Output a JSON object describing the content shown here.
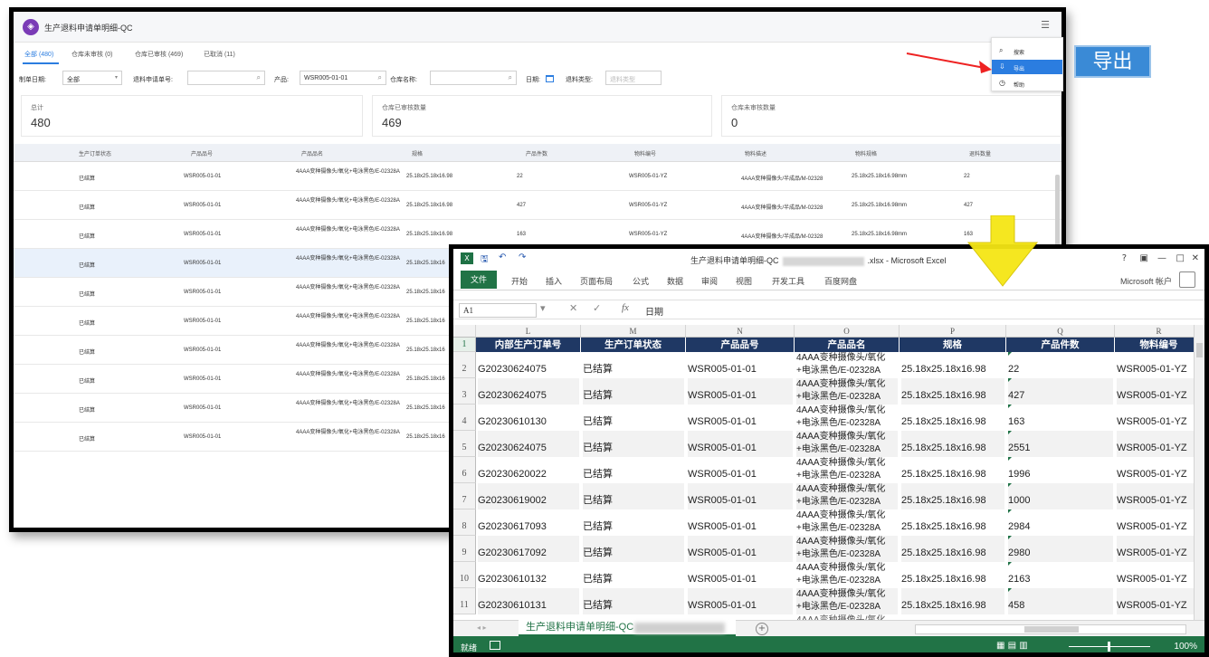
{
  "web": {
    "app_title": "生产退料申请单明细-QC",
    "tabs": [
      "全部 (480)",
      "仓库未审核 (0)",
      "仓库已审核 (469)",
      "已取消 (11)"
    ],
    "filters": {
      "date_label": "制单日期:",
      "date_value": "全部",
      "request_no_label": "退料申请单号:",
      "product_label": "产品:",
      "product_value": "WSR005-01-01",
      "warehouse_label": "仓库名称:",
      "day_label": "日期:",
      "type_label": "退料类型:",
      "type_placeholder": "退料类型"
    },
    "summary": [
      {
        "label": "总计",
        "value": "480"
      },
      {
        "label": "仓库已审核数量",
        "value": "469"
      },
      {
        "label": "仓库未审核数量",
        "value": "0"
      }
    ],
    "columns": [
      "生产订单状态",
      "产品品号",
      "产品品名",
      "规格",
      "产品件数",
      "物料编号",
      "物料描述",
      "物料规格",
      "退料数量"
    ],
    "rows": [
      {
        "status": "已结算",
        "code": "WSR005-01-01",
        "name": "4AAA变种摄像头/氧化+电泳黑色/E-02328A",
        "spec": "25.18x25.18x16.98",
        "qty": "22",
        "mat": "WSR005-01-YZ",
        "mdesc": "4AAA变种摄像头/半成品/M-02328",
        "mspec": "25.18x25.18x16.98mm",
        "ret": "22"
      },
      {
        "status": "已结算",
        "code": "WSR005-01-01",
        "name": "4AAA变种摄像头/氧化+电泳黑色/E-02328A",
        "spec": "25.18x25.18x16.98",
        "qty": "427",
        "mat": "WSR005-01-YZ",
        "mdesc": "4AAA变种摄像头/半成品/M-02328",
        "mspec": "25.18x25.18x16.98mm",
        "ret": "427"
      },
      {
        "status": "已结算",
        "code": "WSR005-01-01",
        "name": "4AAA变种摄像头/氧化+电泳黑色/E-02328A",
        "spec": "25.18x25.18x16.98",
        "qty": "163",
        "mat": "WSR005-01-YZ",
        "mdesc": "4AAA变种摄像头/半成品/M-02328",
        "mspec": "25.18x25.18x16.98mm",
        "ret": "163"
      },
      {
        "status": "已结算",
        "code": "WSR005-01-01",
        "name": "4AAA变种摄像头/氧化+电泳黑色/E-02328A",
        "spec": "25.18x25.18x16"
      },
      {
        "status": "已结算",
        "code": "WSR005-01-01",
        "name": "4AAA变种摄像头/氧化+电泳黑色/E-02328A",
        "spec": "25.18x25.18x16"
      },
      {
        "status": "已结算",
        "code": "WSR005-01-01",
        "name": "4AAA变种摄像头/氧化+电泳黑色/E-02328A",
        "spec": "25.18x25.18x16"
      },
      {
        "status": "已结算",
        "code": "WSR005-01-01",
        "name": "4AAA变种摄像头/氧化+电泳黑色/E-02328A",
        "spec": "25.18x25.18x16"
      },
      {
        "status": "已结算",
        "code": "WSR005-01-01",
        "name": "4AAA变种摄像头/氧化+电泳黑色/E-02328A",
        "spec": "25.18x25.18x16"
      },
      {
        "status": "已结算",
        "code": "WSR005-01-01",
        "name": "4AAA变种摄像头/氧化+电泳黑色/E-02328A",
        "spec": "25.18x25.18x16"
      },
      {
        "status": "已结算",
        "code": "WSR005-01-01",
        "name": "4AAA变种摄像头/氧化+电泳黑色/E-02328A",
        "spec": "25.18x25.18x16"
      }
    ],
    "menu": [
      {
        "icon": "search-icon",
        "label": "搜索"
      },
      {
        "icon": "export-icon",
        "label": "导出"
      },
      {
        "icon": "help-icon",
        "label": "帮助"
      }
    ],
    "callout": "导出"
  },
  "excel": {
    "title": "生产退料申请单明细-QC",
    "title_suffix": ".xlsx - Microsoft Excel",
    "ribbon_tabs": [
      "开始",
      "插入",
      "页面布局",
      "公式",
      "数据",
      "审阅",
      "视图",
      "开发工具",
      "百度网盘"
    ],
    "file_tab": "文件",
    "account": "Microsoft 帐户",
    "name_box": "A1",
    "formula_value": "日期",
    "col_letters": [
      "L",
      "M",
      "N",
      "O",
      "P",
      "Q",
      "R"
    ],
    "headers": [
      "内部生产订单号",
      "生产订单状态",
      "产品品号",
      "产品品名",
      "规格",
      "产品件数",
      "物料编号"
    ],
    "rows": [
      {
        "n": "2",
        "order": "G20230624075",
        "status": "已结算",
        "code": "WSR005-01-01",
        "name1": "4AAA变种摄像头/氧化",
        "name2": "+电泳黑色/E-02328A",
        "spec": "25.18x25.18x16.98",
        "qty": "22",
        "mat": "WSR005-01-YZ"
      },
      {
        "n": "3",
        "order": "G20230624075",
        "status": "已结算",
        "code": "WSR005-01-01",
        "name1": "4AAA变种摄像头/氧化",
        "name2": "+电泳黑色/E-02328A",
        "spec": "25.18x25.18x16.98",
        "qty": "427",
        "mat": "WSR005-01-YZ"
      },
      {
        "n": "4",
        "order": "G20230610130",
        "status": "已结算",
        "code": "WSR005-01-01",
        "name1": "4AAA变种摄像头/氧化",
        "name2": "+电泳黑色/E-02328A",
        "spec": "25.18x25.18x16.98",
        "qty": "163",
        "mat": "WSR005-01-YZ"
      },
      {
        "n": "5",
        "order": "G20230624075",
        "status": "已结算",
        "code": "WSR005-01-01",
        "name1": "4AAA变种摄像头/氧化",
        "name2": "+电泳黑色/E-02328A",
        "spec": "25.18x25.18x16.98",
        "qty": "2551",
        "mat": "WSR005-01-YZ"
      },
      {
        "n": "6",
        "order": "G20230620022",
        "status": "已结算",
        "code": "WSR005-01-01",
        "name1": "4AAA变种摄像头/氧化",
        "name2": "+电泳黑色/E-02328A",
        "spec": "25.18x25.18x16.98",
        "qty": "1996",
        "mat": "WSR005-01-YZ"
      },
      {
        "n": "7",
        "order": "G20230619002",
        "status": "已结算",
        "code": "WSR005-01-01",
        "name1": "4AAA变种摄像头/氧化",
        "name2": "+电泳黑色/E-02328A",
        "spec": "25.18x25.18x16.98",
        "qty": "1000",
        "mat": "WSR005-01-YZ"
      },
      {
        "n": "8",
        "order": "G20230617093",
        "status": "已结算",
        "code": "WSR005-01-01",
        "name1": "4AAA变种摄像头/氧化",
        "name2": "+电泳黑色/E-02328A",
        "spec": "25.18x25.18x16.98",
        "qty": "2984",
        "mat": "WSR005-01-YZ"
      },
      {
        "n": "9",
        "order": "G20230617092",
        "status": "已结算",
        "code": "WSR005-01-01",
        "name1": "4AAA变种摄像头/氧化",
        "name2": "+电泳黑色/E-02328A",
        "spec": "25.18x25.18x16.98",
        "qty": "2980",
        "mat": "WSR005-01-YZ"
      },
      {
        "n": "10",
        "order": "G20230610132",
        "status": "已结算",
        "code": "WSR005-01-01",
        "name1": "4AAA变种摄像头/氧化",
        "name2": "+电泳黑色/E-02328A",
        "spec": "25.18x25.18x16.98",
        "qty": "2163",
        "mat": "WSR005-01-YZ"
      },
      {
        "n": "11",
        "order": "G20230610131",
        "status": "已结算",
        "code": "WSR005-01-01",
        "name1": "4AAA变种摄像头/氧化",
        "name2": "+电泳黑色/E-02328A",
        "spec": "25.18x25.18x16.98",
        "qty": "458",
        "mat": "WSR005-01-YZ"
      }
    ],
    "last_name1": "4AAA变种摄像头/氧化",
    "sheet_tab": "生产退料申请单明细-QC",
    "status_ready": "就绪",
    "zoom": "100%",
    "colors": {
      "excel_green": "#217346",
      "header_navy": "#1f3864",
      "web_accent": "#2b7de0"
    }
  }
}
